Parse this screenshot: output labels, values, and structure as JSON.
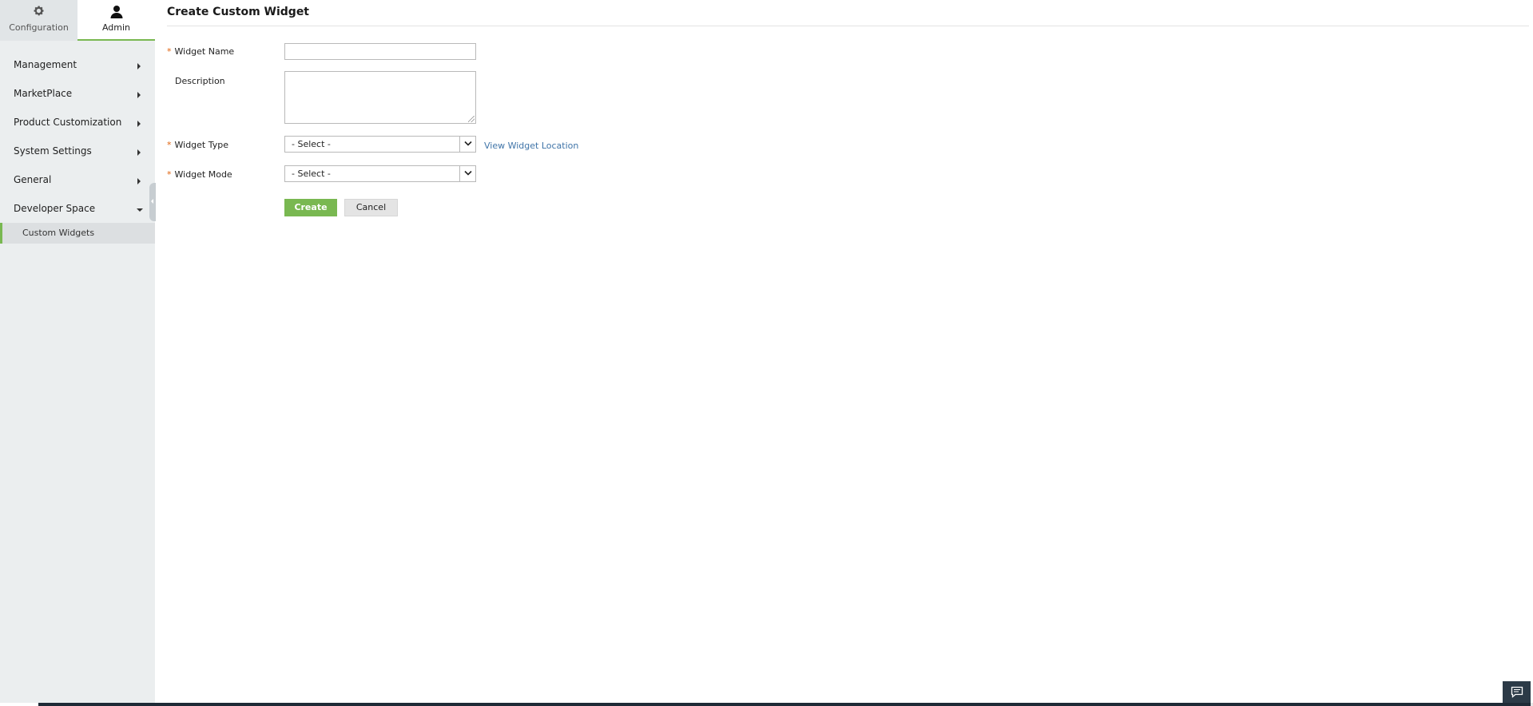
{
  "sidebar": {
    "tabs": [
      {
        "label": "Configuration",
        "icon": "gear-icon",
        "active": false
      },
      {
        "label": "Admin",
        "icon": "user-icon",
        "active": true
      }
    ],
    "items": [
      {
        "label": "Management",
        "expanded": false
      },
      {
        "label": "MarketPlace",
        "expanded": false
      },
      {
        "label": "Product Customization",
        "expanded": false
      },
      {
        "label": "System Settings",
        "expanded": false
      },
      {
        "label": "General",
        "expanded": false
      },
      {
        "label": "Developer Space",
        "expanded": true
      }
    ],
    "sub_items": [
      {
        "label": "Custom Widgets",
        "selected": true
      }
    ]
  },
  "page": {
    "title": "Create Custom Widget"
  },
  "form": {
    "required_marker": "*",
    "widget_name": {
      "label": "Widget Name",
      "value": "",
      "required": true
    },
    "description": {
      "label": "Description",
      "value": "",
      "required": false
    },
    "widget_type": {
      "label": "Widget Type",
      "value": "- Select -",
      "required": true
    },
    "widget_mode": {
      "label": "Widget Mode",
      "value": "- Select -",
      "required": true
    },
    "view_location_link": "View Widget Location",
    "create_label": "Create",
    "cancel_label": "Cancel"
  },
  "colors": {
    "accent_green": "#79b851",
    "link_blue": "#3f74a8",
    "required_orange": "#e0630f",
    "sidebar_bg": "#ebeeef"
  }
}
